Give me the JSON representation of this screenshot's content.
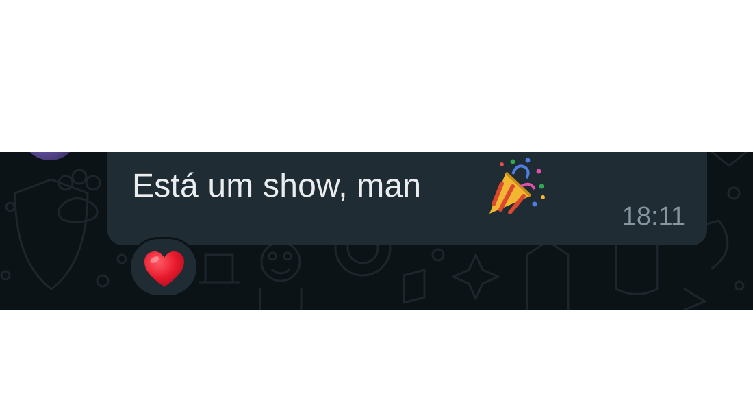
{
  "message": {
    "text": "Está um show, man",
    "emoji": "party-popper-icon",
    "time": "18:11"
  },
  "reaction": {
    "emoji": "heart-icon",
    "count": 1
  },
  "colors": {
    "chat_background": "#0c1317",
    "bubble": "#1f2c33",
    "text": "#e9edef",
    "timestamp": "#8696a0",
    "heart": "#e8192c"
  }
}
